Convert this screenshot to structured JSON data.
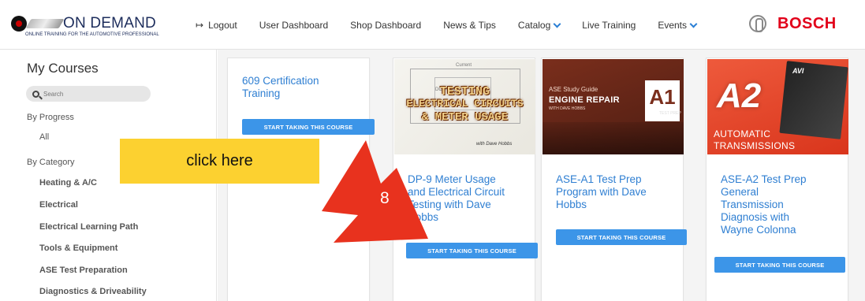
{
  "header": {
    "logo_text": "ON DEMAND",
    "logo_sub": "ONLINE TRAINING FOR THE AUTOMOTIVE PROFESSIONAL",
    "nav": [
      {
        "label": "Logout",
        "icon": "logout-icon"
      },
      {
        "label": "User Dashboard"
      },
      {
        "label": "Shop Dashboard"
      },
      {
        "label": "News & Tips"
      },
      {
        "label": "Catalog",
        "dropdown": true
      },
      {
        "label": "Live Training"
      },
      {
        "label": "Events",
        "dropdown": true
      }
    ],
    "brand": "BOSCH"
  },
  "sidebar": {
    "title": "My Courses",
    "search_placeholder": "Search",
    "by_progress": "By Progress",
    "progress_items": [
      "All"
    ],
    "by_category": "By Category",
    "categories": [
      "Heating & A/C",
      "Electrical",
      "Electrical Learning Path",
      "Tools & Equipment",
      "ASE Test Preparation",
      "Diagnostics & Driveability"
    ]
  },
  "courses": [
    {
      "title": "609 Certification Training",
      "title_lines": [
        "609 Certification",
        "Training"
      ],
      "button": "START TAKING THIS COURSE"
    },
    {
      "title": "DP-9 Meter Usage and Electrical Circuit Testing with Dave Hobbs",
      "title_lines": [
        "DP-9 Meter Usage",
        "and Electrical Circuit",
        "Testing with Dave",
        "Hobbs"
      ],
      "button": "START TAKING THIS COURSE",
      "thumb": {
        "line1": "TESTING",
        "line2": "ELECTRICAL CIRCUITS",
        "line3": "& METER USAGE",
        "author": "with Dave Hobbs",
        "label_current": "Current",
        "label_power": "DC Power"
      }
    },
    {
      "title": "ASE-A1 Test Prep Program with Dave Hobbs",
      "title_lines": [
        "ASE-A1 Test Prep",
        "Program with Dave",
        "Hobbs"
      ],
      "button": "START TAKING THIS COURSE",
      "thumb": {
        "guide": "ASE Study Guide",
        "heading": "ENGINE REPAIR",
        "author": "WITH DAVE HOBBS",
        "code": "A1",
        "tag": "TEST PREP"
      }
    },
    {
      "title": "ASE-A2 Test Prep General Transmission Diagnosis with Wayne Colonna",
      "title_lines": [
        "ASE-A2 Test Prep",
        "General",
        "Transmission",
        "Diagnosis with",
        "Wayne Colonna"
      ],
      "button": "START TAKING THIS COURSE",
      "thumb": {
        "code": "A2",
        "brand": "AVI",
        "line1": "AUTOMATIC",
        "line2": "TRANSMISSIONS"
      }
    }
  ],
  "annotation": {
    "callout": "click here",
    "step": "8",
    "callout_color": "#fcd130",
    "arrow_color": "#e8321e"
  }
}
